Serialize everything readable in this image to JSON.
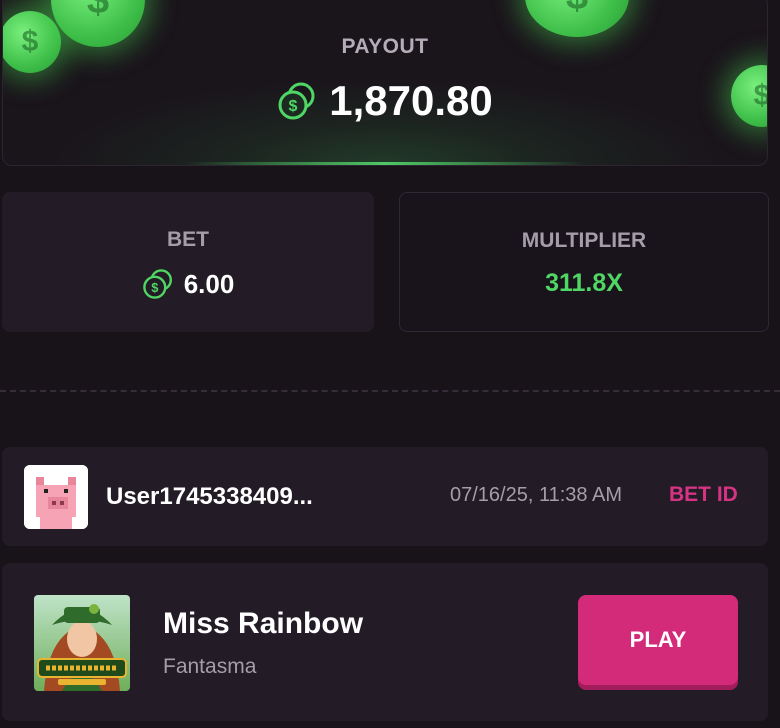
{
  "payout": {
    "label": "PAYOUT",
    "amount": "1,870.80",
    "currency_icon": "coin-icon"
  },
  "bet": {
    "label": "BET",
    "amount": "6.00",
    "currency_icon": "coin-icon"
  },
  "multiplier": {
    "label": "MULTIPLIER",
    "value": "311.8X"
  },
  "bet_info": {
    "username": "User1745338409...",
    "timestamp": "07/16/25, 11:38 AM",
    "bet_id_label": "BET ID",
    "avatar_icon": "pig-avatar-icon"
  },
  "game": {
    "title": "Miss Rainbow",
    "provider": "Fantasma",
    "play_label": "PLAY",
    "thumbnail_icon": "game-thumbnail"
  },
  "colors": {
    "background": "#181219",
    "card": "#231c26",
    "accent_pink": "#d42a7a",
    "accent_green": "#4fd664",
    "muted_text": "#a59ea9"
  }
}
